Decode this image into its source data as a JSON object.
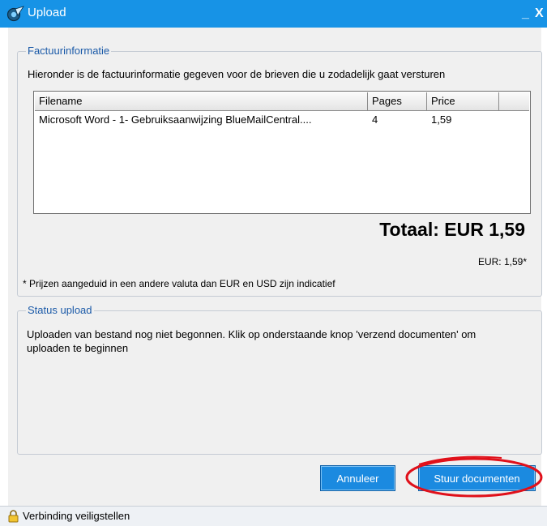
{
  "window": {
    "title": "Upload",
    "minimize_glyph": "_",
    "close_glyph": "X",
    "icon": "app-logo-icon"
  },
  "invoice": {
    "legend": "Factuurinformatie",
    "intro": "Hieronder is de factuurinformatie gegeven voor de brieven die u zodadelijk gaat versturen",
    "columns": [
      "Filename",
      "Pages",
      "Price"
    ],
    "rows": [
      {
        "filename": "Microsoft Word - 1- Gebruiksaanwijzing BlueMailCentral....",
        "pages": "4",
        "price": "1,59"
      }
    ],
    "total": "Totaal: EUR 1,59",
    "eur_note": "EUR: 1,59*",
    "disclaimer": "* Prijzen aangeduid in een andere valuta dan EUR en USD zijn indicatief"
  },
  "status": {
    "legend": "Status upload",
    "message": "Uploaden van bestand nog niet begonnen. Klik op onderstaande knop 'verzend documenten' om uploaden te beginnen"
  },
  "buttons": {
    "cancel": "Annuleer",
    "send": "Stuur documenten"
  },
  "statusbar": {
    "icon": "lock-icon",
    "text": "Verbinding veiligstellen"
  },
  "colors": {
    "titlebar": "#1793e6",
    "button": "#1b8ae0",
    "legend_text": "#1b5aa8",
    "highlight": "#e0101a"
  }
}
